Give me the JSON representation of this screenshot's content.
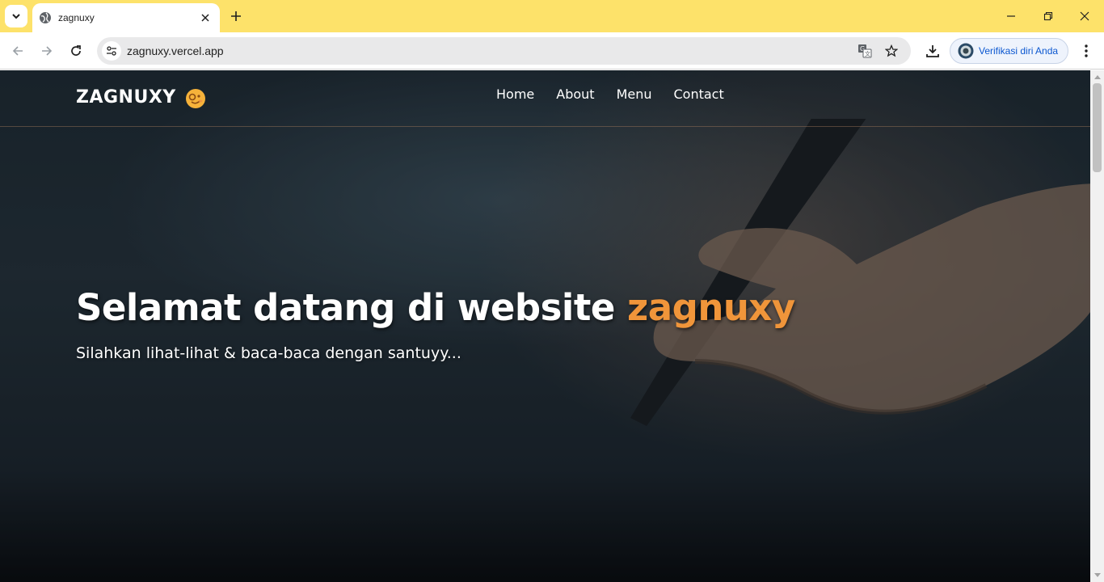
{
  "browser": {
    "tab_title": "zagnuxy",
    "url": "zagnuxy.vercel.app",
    "profile_label": "Verifikasi diri Anda"
  },
  "site": {
    "logo": "ZAGNUXY",
    "nav": [
      "Home",
      "About",
      "Menu",
      "Contact"
    ],
    "hero_title_main": "Selamat datang di website ",
    "hero_title_accent": "zagnuxy",
    "hero_subtitle": "Silahkan lihat-lihat & baca-baca dengan santuyy..."
  },
  "colors": {
    "tabbar": "#fde26a",
    "accent": "#f0953a",
    "profile_text": "#0b57d0"
  },
  "icons": [
    "tab-search-icon",
    "globe-icon",
    "close-icon",
    "plus-icon",
    "minimize-icon",
    "restore-icon",
    "window-close-icon",
    "back-icon",
    "forward-icon",
    "reload-icon",
    "site-info-icon",
    "translate-icon",
    "star-icon",
    "download-icon",
    "menu-icon",
    "emoji-icon"
  ]
}
